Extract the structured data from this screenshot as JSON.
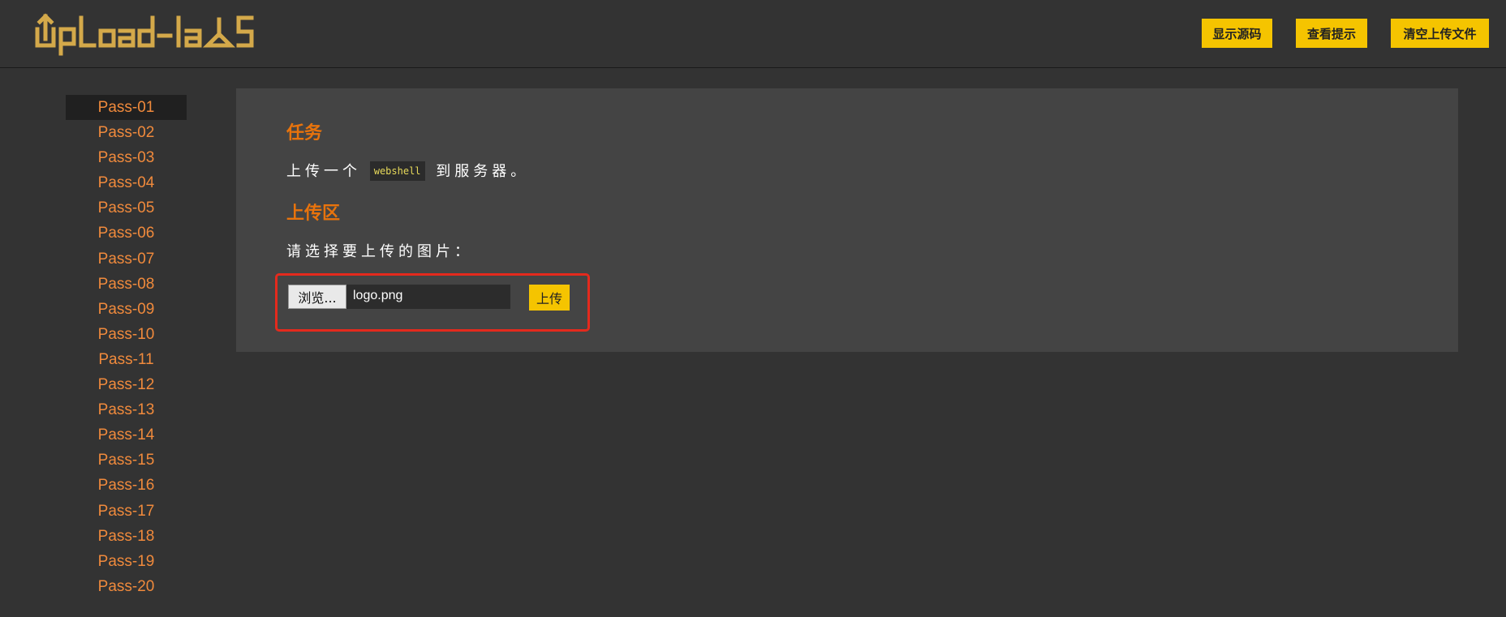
{
  "header": {
    "logo_text": "UpLoad-labS",
    "buttons": {
      "show_source": "显示源码",
      "view_hint": "查看提示",
      "clear_uploads": "清空上传文件"
    }
  },
  "sidebar": {
    "active": "Pass-01",
    "items": [
      "Pass-01",
      "Pass-02",
      "Pass-03",
      "Pass-04",
      "Pass-05",
      "Pass-06",
      "Pass-07",
      "Pass-08",
      "Pass-09",
      "Pass-10",
      "Pass-11",
      "Pass-12",
      "Pass-13",
      "Pass-14",
      "Pass-15",
      "Pass-16",
      "Pass-17",
      "Pass-18",
      "Pass-19",
      "Pass-20"
    ]
  },
  "main": {
    "task_title": "任务",
    "task_text_before": "上传一个",
    "task_code": "webshell",
    "task_text_after": "到服务器。",
    "upload_title": "上传区",
    "upload_prompt": "请选择要上传的图片：",
    "browse_label": "浏览...",
    "file_name": "logo.png",
    "upload_button": "上传"
  },
  "colors": {
    "background": "#333333",
    "panel": "#444444",
    "accent_yellow": "#f5c400",
    "accent_orange": "#e8730c",
    "highlight_red": "#e42a1d"
  }
}
